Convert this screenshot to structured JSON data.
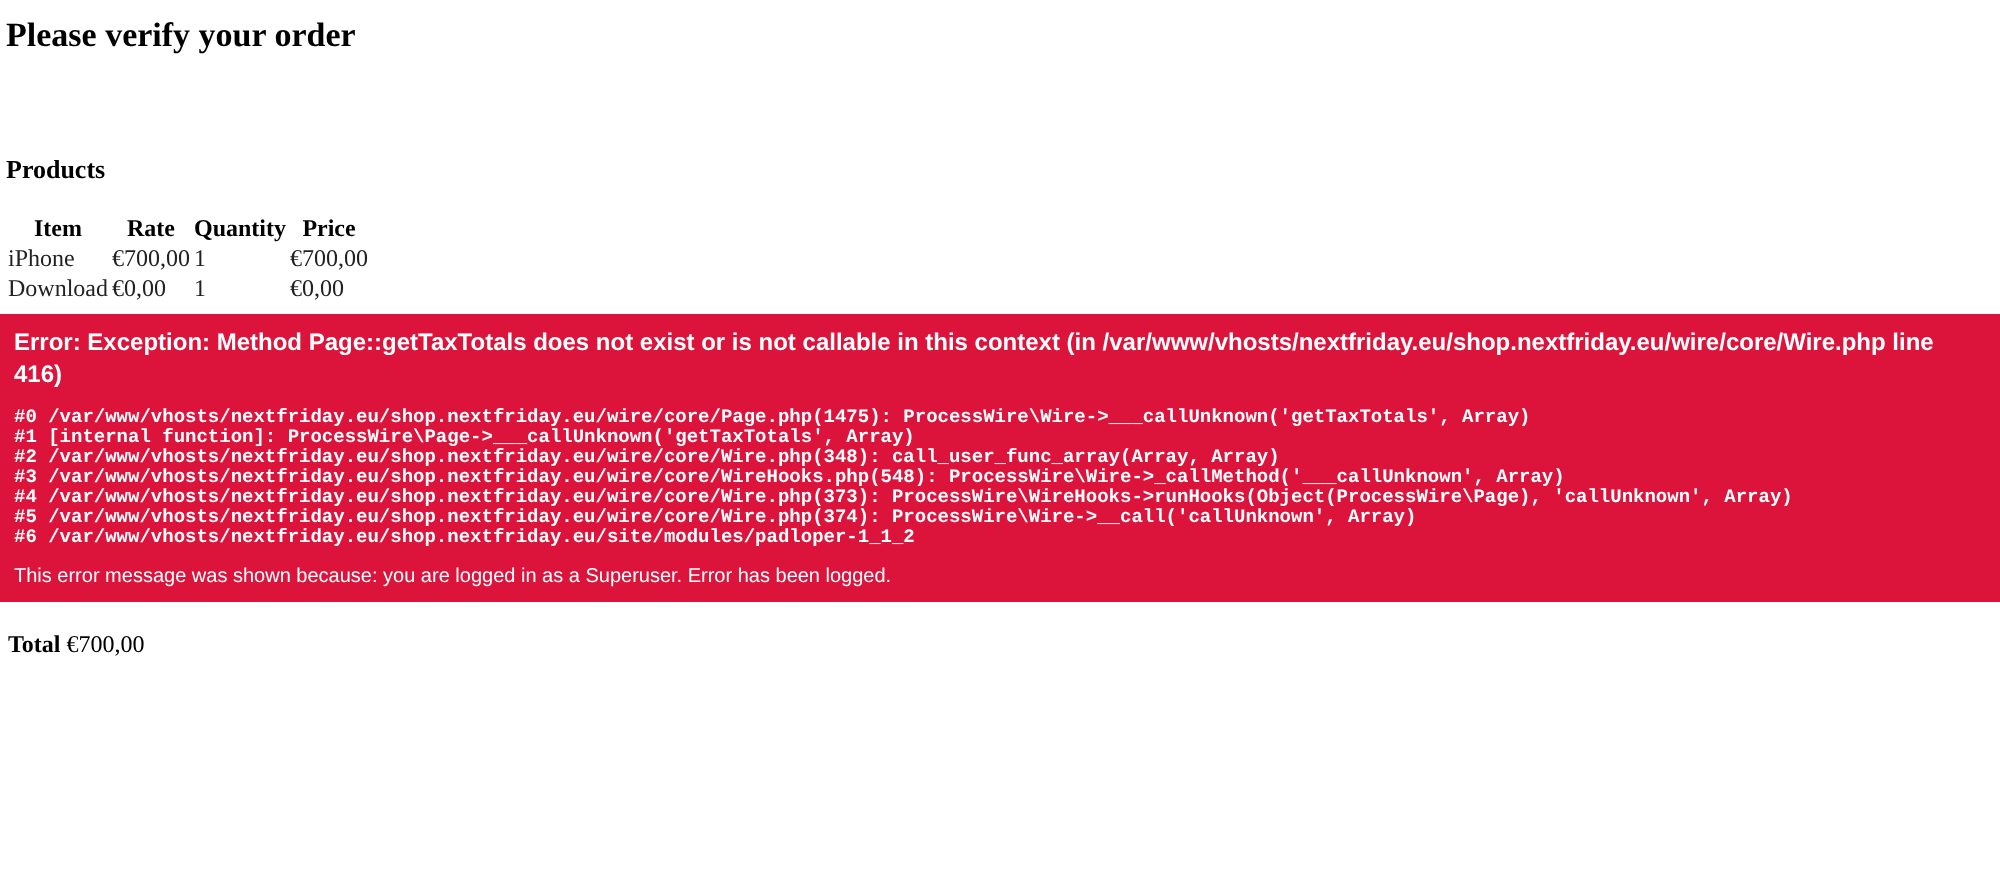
{
  "title": "Please verify your order",
  "products": {
    "heading": "Products",
    "columns": [
      "Item",
      "Rate",
      "Quantity",
      "Price"
    ],
    "rows": [
      [
        "iPhone",
        "€700,00",
        "1",
        "€700,00"
      ],
      [
        "Download",
        "€0,00",
        "1",
        "€0,00"
      ]
    ]
  },
  "error": {
    "title": "Error: Exception: Method Page::getTaxTotals does not exist or is not callable in this context (in /var/www/vhosts/nextfriday.eu/shop.nextfriday.eu/wire/core/Wire.php line 416)",
    "trace": [
      "#0 /var/www/vhosts/nextfriday.eu/shop.nextfriday.eu/wire/core/Page.php(1475): ProcessWire\\Wire->___callUnknown('getTaxTotals', Array)",
      "#1 [internal function]: ProcessWire\\Page->___callUnknown('getTaxTotals', Array)",
      "#2 /var/www/vhosts/nextfriday.eu/shop.nextfriday.eu/wire/core/Wire.php(348): call_user_func_array(Array, Array)",
      "#3 /var/www/vhosts/nextfriday.eu/shop.nextfriday.eu/wire/core/WireHooks.php(548): ProcessWire\\Wire->_callMethod('___callUnknown', Array)",
      "#4 /var/www/vhosts/nextfriday.eu/shop.nextfriday.eu/wire/core/Wire.php(373): ProcessWire\\WireHooks->runHooks(Object(ProcessWire\\Page), 'callUnknown', Array)",
      "#5 /var/www/vhosts/nextfriday.eu/shop.nextfriday.eu/wire/core/Wire.php(374): ProcessWire\\Wire->__call('callUnknown', Array)",
      "#6 /var/www/vhosts/nextfriday.eu/shop.nextfriday.eu/site/modules/padloper-1_1_2"
    ],
    "note": "This error message was shown because: you are logged in as a Superuser. Error has been logged."
  },
  "total": "**Total** €700,00"
}
